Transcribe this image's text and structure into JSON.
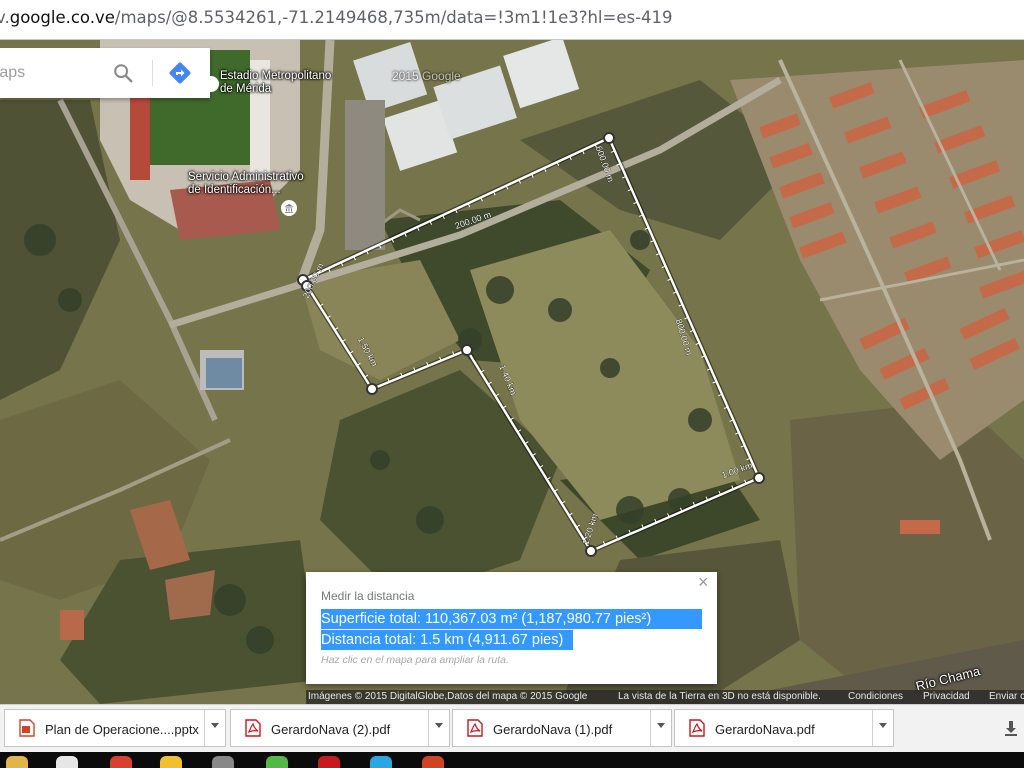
{
  "browser": {
    "address_prefix": "v.",
    "address_host": "google.co.ve",
    "address_path": "/maps/@8.5534261,-71.2149468,735m/data=!3m1!1e3?hl=es-419"
  },
  "search": {
    "placeholder": "Maps"
  },
  "map_labels": {
    "stadium_line1": "Estadio Metropolitano",
    "stadium_line2": "de Mérida",
    "saime_line1": "Servicio Administrativo",
    "saime_line2": "de Identificación...",
    "river": "Río Chama",
    "watermark": "2015 Google"
  },
  "segments": {
    "s1": "200.00 m",
    "s2": "200.00 m",
    "s3": "600.00 m",
    "s4": "800.00 m",
    "s5": "1.00 km",
    "s6": "1.20 km",
    "s7": "1.40 km",
    "s8": "1.50 km"
  },
  "measure": {
    "title": "Medir la distancia",
    "area": "Superficie total: 110,367.03 m² (1,187,980.77 pies²)",
    "distance": "Distancia total: 1.5 km (4,911.67 pies)",
    "hint": "Haz clic en el mapa para ampliar la ruta.",
    "close": "×"
  },
  "attribution": {
    "imagery": "Imágenes © 2015 DigitalGlobe,Datos del mapa © 2015 Google",
    "earth": "La vista de la Tierra en 3D no está disponible.",
    "terms": "Condiciones",
    "privacy": "Privacidad",
    "feedback": "Enviar c"
  },
  "downloads": [
    {
      "name": "Plan de Operacione....pptx",
      "type": "pptx"
    },
    {
      "name": "GerardoNava (2).pdf",
      "type": "pdf"
    },
    {
      "name": "GerardoNava (1).pdf",
      "type": "pdf"
    },
    {
      "name": "GerardoNava.pdf",
      "type": "pdf"
    }
  ],
  "colors": {
    "selection": "#3399ff",
    "pptx_icon": "#d04423",
    "pdf_icon": "#c8191e",
    "route_line": "#ffffff",
    "directions_icon": "#4285f4"
  }
}
